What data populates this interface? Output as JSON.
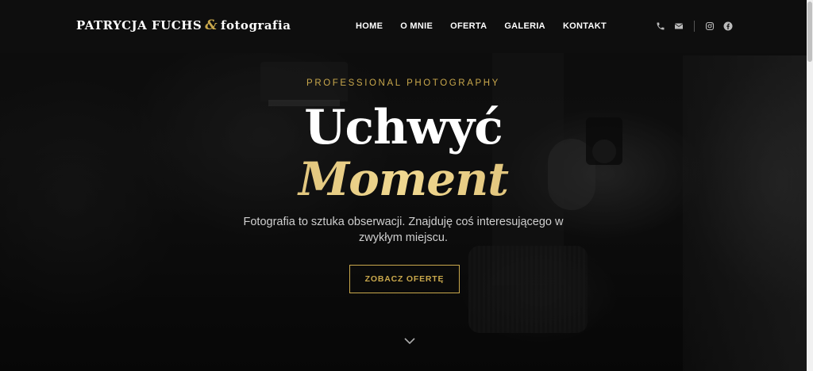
{
  "header": {
    "logo_name": "PATRYCJA FUCHS",
    "logo_amp": "&",
    "logo_sub": "fotografia",
    "nav": [
      "HOME",
      "O MNIE",
      "OFERTA",
      "GALERIA",
      "KONTAKT"
    ],
    "icons": [
      "phone-icon",
      "mail-icon",
      "instagram-icon",
      "facebook-icon"
    ]
  },
  "hero": {
    "eyebrow": "PROFESSIONAL PHOTOGRAPHY",
    "title_line1": "Uchwyć",
    "title_line2": "Moment",
    "description_line1": "Fotografia to sztuka obserwacji. Znajduję coś interesującego w",
    "description_line2": "zwykłym miejscu.",
    "cta_label": "ZOBACZ OFERTĘ",
    "scroll_icon": "chevron-down-icon"
  },
  "colors": {
    "accent_gold": "#c9a84c",
    "header_bg": "#0e0e0e"
  }
}
